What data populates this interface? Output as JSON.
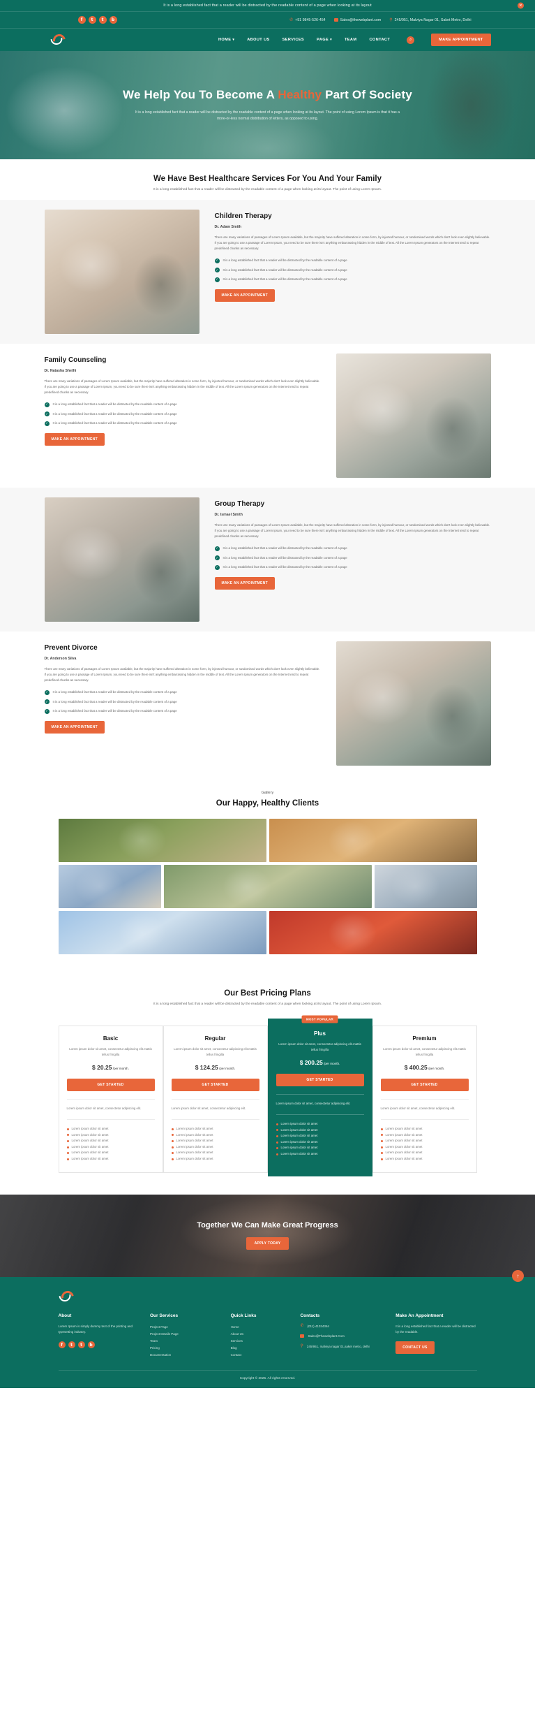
{
  "announce": {
    "text": "It is a long established fact that a reader will be distracted by the readable content of a page when looking at its layout",
    "close_icon": "✕"
  },
  "topbar": {
    "socials": [
      {
        "name": "facebook",
        "glyph": "f"
      },
      {
        "name": "twitter",
        "glyph": "🐦"
      },
      {
        "name": "tumblr",
        "glyph": "t"
      },
      {
        "name": "blogger",
        "glyph": "b"
      }
    ],
    "phone": "+91 9845-526-454",
    "email": "Sales@thewebplant.com",
    "address": "245/951, Malviya Nagar 01, Saket Metro, Delhi"
  },
  "nav": {
    "items": [
      {
        "label": "HOME",
        "has_caret": true
      },
      {
        "label": "ABOUT US",
        "has_caret": false
      },
      {
        "label": "SERVICES",
        "has_caret": false
      },
      {
        "label": "PAGE",
        "has_caret": true
      },
      {
        "label": "TEAM",
        "has_caret": false
      },
      {
        "label": "CONTACT",
        "has_caret": false
      }
    ],
    "search_icon": "⌕",
    "appointment_label": "MAKE APPOINTMENT"
  },
  "hero": {
    "title_pre": "We Help You To Become A ",
    "title_highlight": "Healthy",
    "title_post": " Part Of Society",
    "subtitle": "It is a long established fact that a reader will be distracted by the readable content of a page when looking at its layout. The point of using Lorem Ipsum is that it has a more-or-less normal distribution of letters, as opposed to using."
  },
  "services_header": {
    "title": "We Have Best Healthcare Services For You And Your Family",
    "subtitle": "It is a long established fact that a reader will be distracted by the readable content of a page when looking at its layout. The point of using Lorem Ipsum."
  },
  "services": [
    {
      "title": "Children Therapy",
      "doctor": "Dr. Adam Smith",
      "body": "There are many variations of passages of Lorem Ipsum available, but the majority have suffered alteration in some form, by injected humour, or randomised words which don't look even slightly believable. If you are going to use a passage of Lorem Ipsum, you need to be sure there isn't anything embarrassing hidden in the middle of text. All the Lorem Ipsum generators on the Internet tend to repeat predefined chunks as necessary.",
      "features": [
        "It is a long established fact that a reader will be distracted by the readable content of a page",
        "It is a long established fact that a reader will be distracted by the readable content of a page",
        "It is a long established fact that a reader will be distracted by the readable content of a page"
      ],
      "button": "MAKE AN APPOINTMENT"
    },
    {
      "title": "Family Counseling",
      "doctor": "Dr. Natasha Shethi",
      "body": "There are many variations of passages of Lorem Ipsum available, but the majority have suffered alteration in some form, by injected humour, or randomised words which don't look even slightly believable. If you are going to use a passage of Lorem Ipsum, you need to be sure there isn't anything embarrassing hidden in the middle of text. All the Lorem Ipsum generators on the Internet tend to repeat predefined chunks as necessary.",
      "features": [
        "It is a long established fact that a reader will be distracted by the readable content of a page",
        "It is a long established fact that a reader will be distracted by the readable content of a page",
        "It is a long established fact that a reader will be distracted by the readable content of a page"
      ],
      "button": "MAKE AN APPOINTMENT"
    },
    {
      "title": "Group Therapy",
      "doctor": "Dr. Ismael Smith",
      "body": "There are many variations of passages of Lorem Ipsum available, but the majority have suffered alteration in some form, by injected humour, or randomised words which don't look even slightly believable. If you are going to use a passage of Lorem Ipsum, you need to be sure there isn't anything embarrassing hidden in the middle of text. All the Lorem Ipsum generators on the Internet tend to repeat predefined chunks as necessary.",
      "features": [
        "It is a long established fact that a reader will be distracted by the readable content of a page",
        "It is a long established fact that a reader will be distracted by the readable content of a page",
        "It is a long established fact that a reader will be distracted by the readable content of a page"
      ],
      "button": "MAKE AN APPOINTMENT"
    },
    {
      "title": "Prevent Divorce",
      "doctor": "Dr. Anderson Silva",
      "body": "There are many variations of passages of Lorem Ipsum available, but the majority have suffered alteration in some form, by injected humour, or randomised words which don't look even slightly believable. If you are going to use a passage of Lorem Ipsum, you need to be sure there isn't anything embarrassing hidden in the middle of text. All the Lorem Ipsum generators on the Internet tend to repeat predefined chunks as necessary.",
      "features": [
        "It is a long established fact that a reader will be distracted by the readable content of a page",
        "It is a long established fact that a reader will be distracted by the readable content of a page",
        "It is a long established fact that a reader will be distracted by the readable content of a page"
      ],
      "button": "MAKE AN APPOINTMENT"
    }
  ],
  "gallery": {
    "eyebrow": "Gallery",
    "title": "Our Happy, Healthy Clients"
  },
  "pricing": {
    "title": "Our Best Pricing Plans",
    "subtitle": "It is a long established fact that a reader will be distracted by the readable content of a page when looking at its layout. The point of using Lorem Ipsum.",
    "most_popular_badge": "MOST POPULAR",
    "plans": [
      {
        "name": "Basic",
        "desc": "Lorem ipsum dolor sit amet, consectetur adipiscing elit.mattis tellus fringilla",
        "price": "$ 20.25",
        "period": "/per month.",
        "button": "GET STARTED",
        "footer_text": "Lorem ipsum dolor sit amet, consectetur adipiscing elit.",
        "features": [
          "Lorem ipsum dolor sit amet",
          "Lorem ipsum dolor sit amet",
          "Lorem ipsum dolor sit amet",
          "Lorem ipsum dolor sit amet",
          "Lorem ipsum dolor sit amet",
          "Lorem ipsum dolor sit amet"
        ],
        "popular": false
      },
      {
        "name": "Regular",
        "desc": "Lorem ipsum dolor sit amet, consectetur adipiscing elit.mattis tellus fringilla",
        "price": "$ 124.25",
        "period": "/per month.",
        "button": "GET STARTED",
        "footer_text": "Lorem ipsum dolor sit amet, consectetur adipiscing elit.",
        "features": [
          "Lorem ipsum dolor sit amet",
          "Lorem ipsum dolor sit amet",
          "Lorem ipsum dolor sit amet",
          "Lorem ipsum dolor sit amet",
          "Lorem ipsum dolor sit amet",
          "Lorem ipsum dolor sit amet"
        ],
        "popular": false
      },
      {
        "name": "Plus",
        "desc": "Lorem ipsum dolor sit amet, consectetur adipiscing elit.mattis tellus fringilla",
        "price": "$ 200.25",
        "period": "/per month.",
        "button": "GET STARTED",
        "footer_text": "Lorem ipsum dolor sit amet, consectetur adipiscing elit.",
        "features": [
          "Lorem ipsum dolor sit amet",
          "Lorem ipsum dolor sit amet",
          "Lorem ipsum dolor sit amet",
          "Lorem ipsum dolor sit amet",
          "Lorem ipsum dolor sit amet",
          "Lorem ipsum dolor sit amet"
        ],
        "popular": true
      },
      {
        "name": "Premium",
        "desc": "Lorem ipsum dolor sit amet, consectetur adipiscing elit.mattis tellus fringilla",
        "price": "$ 400.25",
        "period": "/per month.",
        "button": "GET STARTED",
        "footer_text": "Lorem ipsum dolor sit amet, consectetur adipiscing elit.",
        "features": [
          "Lorem ipsum dolor sit amet",
          "Lorem ipsum dolor sit amet",
          "Lorem ipsum dolor sit amet",
          "Lorem ipsum dolor sit amet",
          "Lorem ipsum dolor sit amet",
          "Lorem ipsum dolor sit amet"
        ],
        "popular": false
      }
    ]
  },
  "cta": {
    "title": "Together We Can Make Great Progress",
    "button": "APPLY TODAY"
  },
  "footer": {
    "about": {
      "heading": "About",
      "text": "Lorem Ipsum is simply dummy text of the printing and typesetting industry.",
      "socials": [
        {
          "name": "facebook",
          "glyph": "f"
        },
        {
          "name": "twitter",
          "glyph": "🐦"
        },
        {
          "name": "tumblr",
          "glyph": "t"
        },
        {
          "name": "blogger",
          "glyph": "b"
        }
      ]
    },
    "services": {
      "heading": "Our Services",
      "links": [
        "Project Page",
        "Project Details Page",
        "Team",
        "Pricing",
        "Documentation"
      ]
    },
    "quick": {
      "heading": "Quick Links",
      "links": [
        "Home",
        "About Us",
        "Services",
        "Blog",
        "Contact"
      ]
    },
    "contacts": {
      "heading": "Contacts",
      "phone": "(011) 41034364",
      "email": "Sales@Thewebplant.Com",
      "address": "245/951, malviya nagar 01,saket metro, delhi"
    },
    "appointment": {
      "heading": "Make An Appointment",
      "text": "It is a long established fact that a reader will be distracted by the readable.",
      "button": "CONTACT US"
    },
    "copyright": "Copyright © 2025. All rights reserved.",
    "scroll_top_icon": "↑"
  },
  "colors": {
    "brand_green": "#0c6e5f",
    "accent_orange": "#e8663a"
  }
}
